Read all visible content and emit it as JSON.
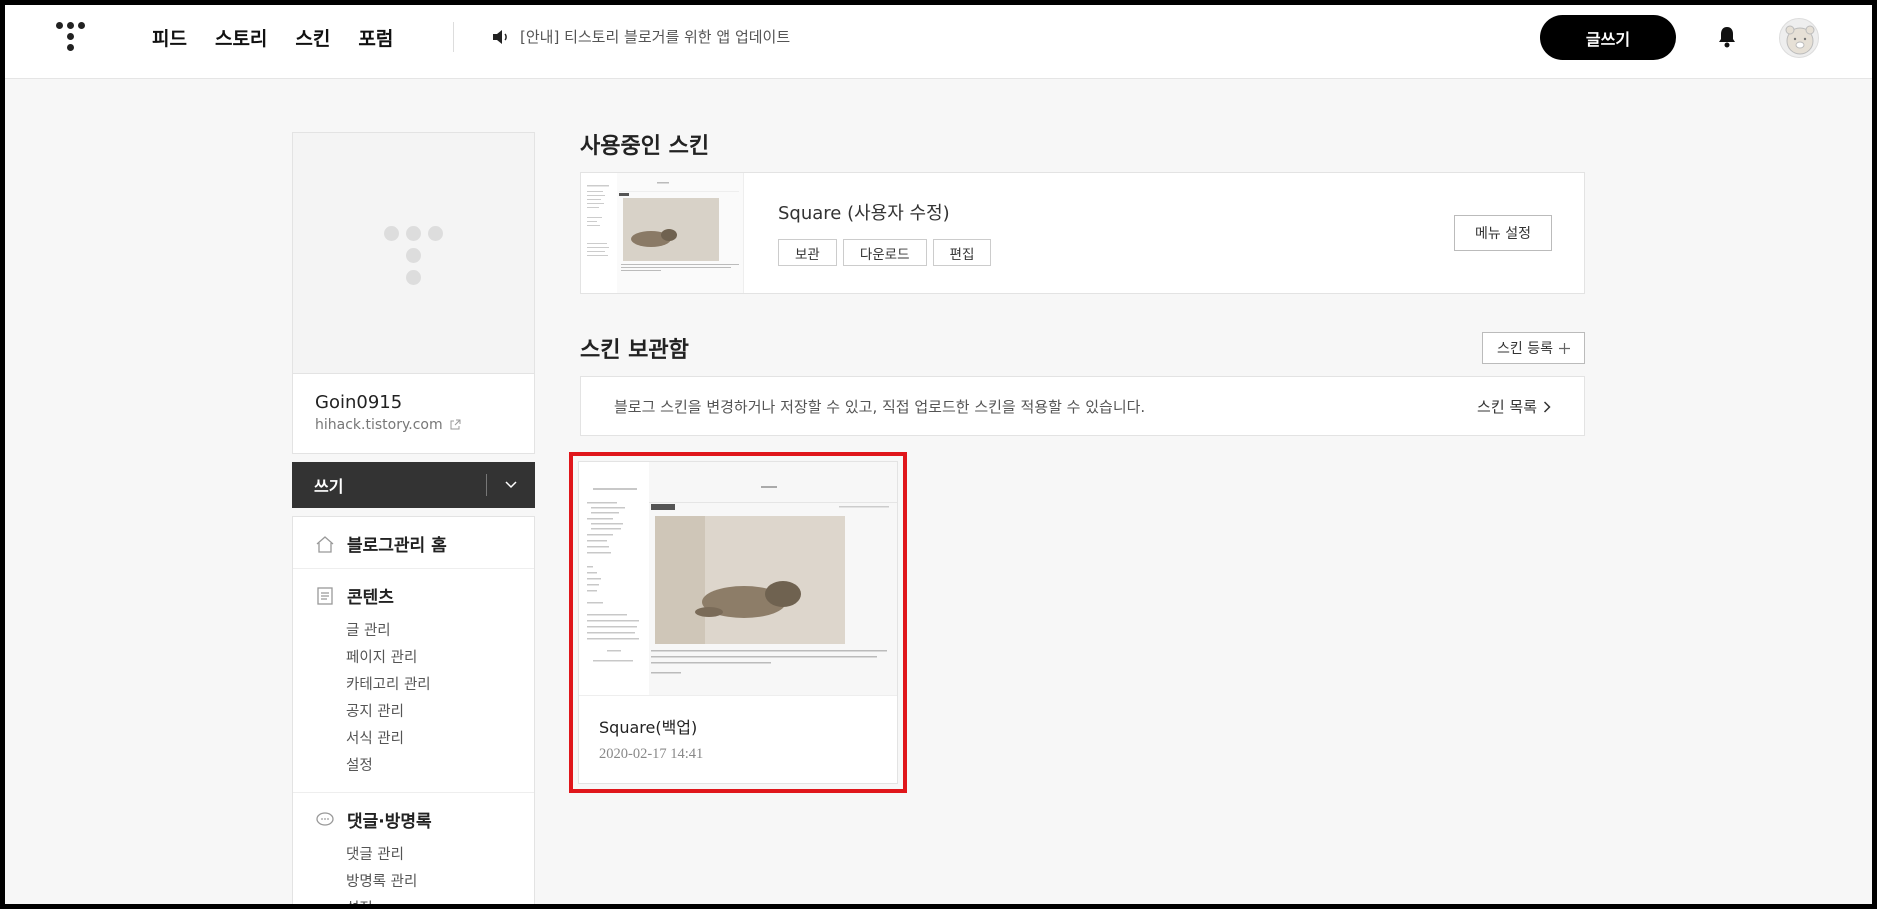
{
  "topbar": {
    "nav": [
      "피드",
      "스토리",
      "스킨",
      "포럼"
    ],
    "notice": "[안내] 티스토리 블로거를 위한 앱 업데이트",
    "write_label": "글쓰기"
  },
  "sidebar": {
    "blog_name": "Goin0915",
    "blog_url": "hihack.tistory.com",
    "write_label": "쓰기",
    "home_label": "블로그관리 홈",
    "contents": {
      "title": "콘텐츠",
      "items": [
        "글 관리",
        "페이지 관리",
        "카테고리 관리",
        "공지 관리",
        "서식 관리",
        "설정"
      ]
    },
    "comments": {
      "title": "댓글·방명록",
      "items": [
        "댓글 관리",
        "방명록 관리",
        "설정"
      ]
    }
  },
  "main": {
    "current_title": "사용중인 스킨",
    "current_skin_name": "Square (사용자 수정)",
    "current_buttons": [
      "보관",
      "다운로드",
      "편집"
    ],
    "menu_settings_label": "메뉴 설정",
    "storage_title": "스킨 보관함",
    "register_label": "스킨 등록",
    "info_text": "블로그 스킨을 변경하거나 저장할 수 있고, 직접 업로드한 스킨을 적용할 수 있습니다.",
    "skin_list_label": "스킨 목록",
    "stored_skin": {
      "name": "Square(백업)",
      "date": "2020-02-17 14:41"
    }
  },
  "colors": {
    "highlight_border": "#e0161b",
    "primary_button": "#000000",
    "write_bar": "#333333"
  }
}
